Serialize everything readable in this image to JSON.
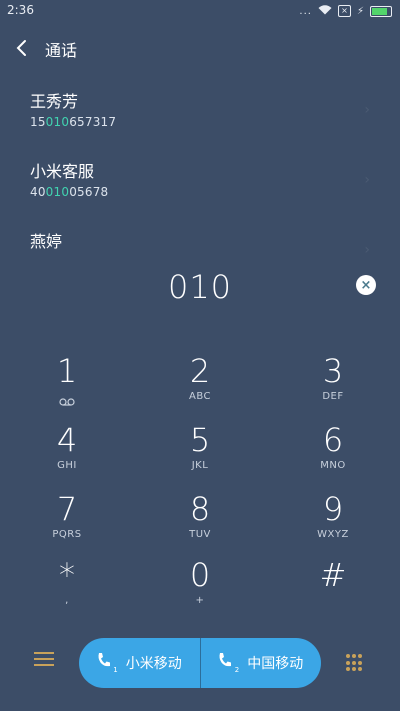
{
  "status": {
    "time": "2:36",
    "dots": "...",
    "sim": "×",
    "charge": "⚡"
  },
  "header": {
    "title": "通话"
  },
  "contacts": [
    {
      "name": "王秀芳",
      "number_pre": "15",
      "number_hl": "010",
      "number_post": "657317"
    },
    {
      "name": "小米客服",
      "number_pre": "40",
      "number_hl": "010",
      "number_post": "05678"
    },
    {
      "name": "燕婷",
      "number_pre": "",
      "number_hl": "",
      "number_post": ""
    }
  ],
  "dial": {
    "input": "010"
  },
  "keys": [
    {
      "digit": "1",
      "letters": ""
    },
    {
      "digit": "2",
      "letters": "ABC"
    },
    {
      "digit": "3",
      "letters": "DEF"
    },
    {
      "digit": "4",
      "letters": "GHI"
    },
    {
      "digit": "5",
      "letters": "JKL"
    },
    {
      "digit": "6",
      "letters": "MNO"
    },
    {
      "digit": "7",
      "letters": "PQRS"
    },
    {
      "digit": "8",
      "letters": "TUV"
    },
    {
      "digit": "9",
      "letters": "WXYZ"
    },
    {
      "digit": "*",
      "letters": ","
    },
    {
      "digit": "0",
      "letters": "+"
    },
    {
      "digit": "#",
      "letters": ""
    }
  ],
  "call": {
    "sim1_label": "小米移动",
    "sim2_label": "中国移动",
    "sim1_index": "1",
    "sim2_index": "2"
  },
  "icons": {
    "back": "back-icon",
    "clear": "clear-icon",
    "menu": "menu-icon",
    "dialpad": "dialpad-icon",
    "phone": "phone-icon",
    "voicemail": "voicemail-icon"
  },
  "colors": {
    "background": "#3c4d67",
    "highlight": "#41d3b0",
    "call_button": "#3ba6e6",
    "accent_icons": "#c9a25a"
  }
}
